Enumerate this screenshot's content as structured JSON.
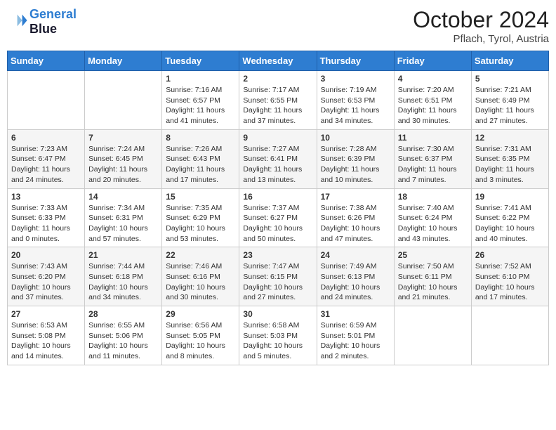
{
  "header": {
    "logo_line1": "General",
    "logo_line2": "Blue",
    "month": "October 2024",
    "location": "Pflach, Tyrol, Austria"
  },
  "weekdays": [
    "Sunday",
    "Monday",
    "Tuesday",
    "Wednesday",
    "Thursday",
    "Friday",
    "Saturday"
  ],
  "weeks": [
    [
      {
        "day": "",
        "info": ""
      },
      {
        "day": "",
        "info": ""
      },
      {
        "day": "1",
        "info": "Sunrise: 7:16 AM\nSunset: 6:57 PM\nDaylight: 11 hours and 41 minutes."
      },
      {
        "day": "2",
        "info": "Sunrise: 7:17 AM\nSunset: 6:55 PM\nDaylight: 11 hours and 37 minutes."
      },
      {
        "day": "3",
        "info": "Sunrise: 7:19 AM\nSunset: 6:53 PM\nDaylight: 11 hours and 34 minutes."
      },
      {
        "day": "4",
        "info": "Sunrise: 7:20 AM\nSunset: 6:51 PM\nDaylight: 11 hours and 30 minutes."
      },
      {
        "day": "5",
        "info": "Sunrise: 7:21 AM\nSunset: 6:49 PM\nDaylight: 11 hours and 27 minutes."
      }
    ],
    [
      {
        "day": "6",
        "info": "Sunrise: 7:23 AM\nSunset: 6:47 PM\nDaylight: 11 hours and 24 minutes."
      },
      {
        "day": "7",
        "info": "Sunrise: 7:24 AM\nSunset: 6:45 PM\nDaylight: 11 hours and 20 minutes."
      },
      {
        "day": "8",
        "info": "Sunrise: 7:26 AM\nSunset: 6:43 PM\nDaylight: 11 hours and 17 minutes."
      },
      {
        "day": "9",
        "info": "Sunrise: 7:27 AM\nSunset: 6:41 PM\nDaylight: 11 hours and 13 minutes."
      },
      {
        "day": "10",
        "info": "Sunrise: 7:28 AM\nSunset: 6:39 PM\nDaylight: 11 hours and 10 minutes."
      },
      {
        "day": "11",
        "info": "Sunrise: 7:30 AM\nSunset: 6:37 PM\nDaylight: 11 hours and 7 minutes."
      },
      {
        "day": "12",
        "info": "Sunrise: 7:31 AM\nSunset: 6:35 PM\nDaylight: 11 hours and 3 minutes."
      }
    ],
    [
      {
        "day": "13",
        "info": "Sunrise: 7:33 AM\nSunset: 6:33 PM\nDaylight: 11 hours and 0 minutes."
      },
      {
        "day": "14",
        "info": "Sunrise: 7:34 AM\nSunset: 6:31 PM\nDaylight: 10 hours and 57 minutes."
      },
      {
        "day": "15",
        "info": "Sunrise: 7:35 AM\nSunset: 6:29 PM\nDaylight: 10 hours and 53 minutes."
      },
      {
        "day": "16",
        "info": "Sunrise: 7:37 AM\nSunset: 6:27 PM\nDaylight: 10 hours and 50 minutes."
      },
      {
        "day": "17",
        "info": "Sunrise: 7:38 AM\nSunset: 6:26 PM\nDaylight: 10 hours and 47 minutes."
      },
      {
        "day": "18",
        "info": "Sunrise: 7:40 AM\nSunset: 6:24 PM\nDaylight: 10 hours and 43 minutes."
      },
      {
        "day": "19",
        "info": "Sunrise: 7:41 AM\nSunset: 6:22 PM\nDaylight: 10 hours and 40 minutes."
      }
    ],
    [
      {
        "day": "20",
        "info": "Sunrise: 7:43 AM\nSunset: 6:20 PM\nDaylight: 10 hours and 37 minutes."
      },
      {
        "day": "21",
        "info": "Sunrise: 7:44 AM\nSunset: 6:18 PM\nDaylight: 10 hours and 34 minutes."
      },
      {
        "day": "22",
        "info": "Sunrise: 7:46 AM\nSunset: 6:16 PM\nDaylight: 10 hours and 30 minutes."
      },
      {
        "day": "23",
        "info": "Sunrise: 7:47 AM\nSunset: 6:15 PM\nDaylight: 10 hours and 27 minutes."
      },
      {
        "day": "24",
        "info": "Sunrise: 7:49 AM\nSunset: 6:13 PM\nDaylight: 10 hours and 24 minutes."
      },
      {
        "day": "25",
        "info": "Sunrise: 7:50 AM\nSunset: 6:11 PM\nDaylight: 10 hours and 21 minutes."
      },
      {
        "day": "26",
        "info": "Sunrise: 7:52 AM\nSunset: 6:10 PM\nDaylight: 10 hours and 17 minutes."
      }
    ],
    [
      {
        "day": "27",
        "info": "Sunrise: 6:53 AM\nSunset: 5:08 PM\nDaylight: 10 hours and 14 minutes."
      },
      {
        "day": "28",
        "info": "Sunrise: 6:55 AM\nSunset: 5:06 PM\nDaylight: 10 hours and 11 minutes."
      },
      {
        "day": "29",
        "info": "Sunrise: 6:56 AM\nSunset: 5:05 PM\nDaylight: 10 hours and 8 minutes."
      },
      {
        "day": "30",
        "info": "Sunrise: 6:58 AM\nSunset: 5:03 PM\nDaylight: 10 hours and 5 minutes."
      },
      {
        "day": "31",
        "info": "Sunrise: 6:59 AM\nSunset: 5:01 PM\nDaylight: 10 hours and 2 minutes."
      },
      {
        "day": "",
        "info": ""
      },
      {
        "day": "",
        "info": ""
      }
    ]
  ]
}
